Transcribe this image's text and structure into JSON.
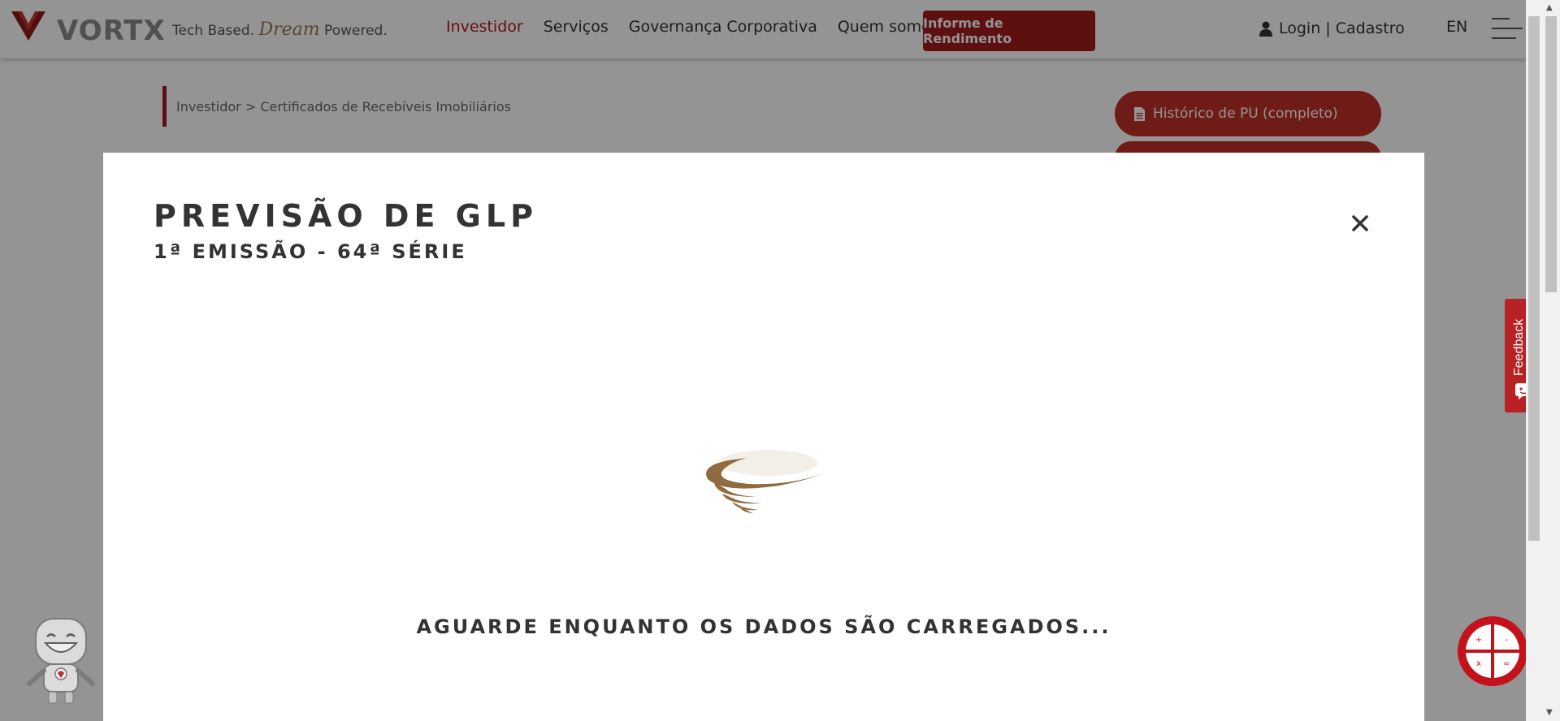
{
  "header": {
    "logo_text": "VORTX",
    "tagline_pre": "Tech Based.",
    "tagline_dream": "Dream",
    "tagline_post": "Powered.",
    "nav": [
      {
        "label": "Investidor",
        "active": true
      },
      {
        "label": "Serviços"
      },
      {
        "label": "Governança Corporativa"
      },
      {
        "label": "Quem somos"
      }
    ],
    "cta_label": "Informe de Rendimento",
    "login_label": "Login | Cadastro",
    "lang_label": "EN"
  },
  "page": {
    "breadcrumb": "Investidor > Certificados de Recebíveis Imobiliários",
    "side_button_label": "Histórico de PU (completo)"
  },
  "modal": {
    "title": "PREVISÃO DE GLP",
    "subtitle": "1ª EMISSÃO - 64ª SÉRIE",
    "loading_text": "AGUARDE ENQUANTO OS DADOS SÃO CARREGADOS..."
  },
  "widgets": {
    "feedback_label": "Feedback"
  },
  "icons": {
    "user": "user-icon",
    "document": "document-icon",
    "close": "close-icon",
    "menu": "hamburger-menu-icon",
    "calculator": "calculator-icon",
    "feedback": "feedback-face-icon",
    "spinner": "loading-spinner-icon"
  },
  "colors": {
    "brand_red": "#a31c1c",
    "accent_gold": "#9a7a4e",
    "overlay": "rgba(0,0,0,0.42)"
  }
}
